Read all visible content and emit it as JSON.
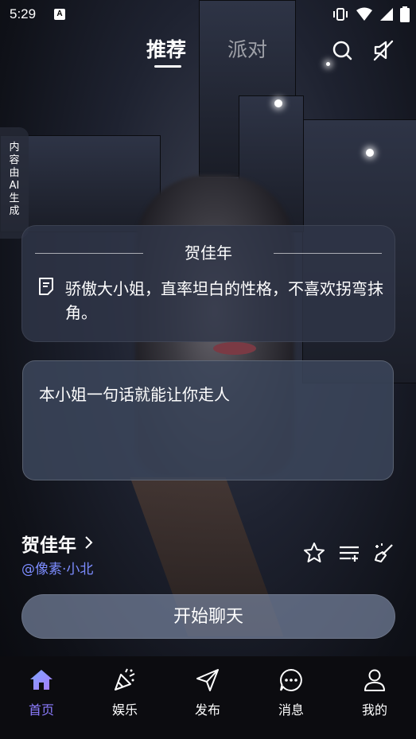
{
  "status_bar": {
    "time": "5:29",
    "app_badge": "A"
  },
  "top_tabs": [
    {
      "label": "推荐",
      "active": true
    },
    {
      "label": "派对",
      "active": false
    }
  ],
  "ai_label": [
    "内",
    "容",
    "由",
    "AI",
    "生",
    "成"
  ],
  "profile_card": {
    "name": "贺佳年",
    "description": "骄傲大小姐，直率坦白的性格，不喜欢拐弯抹角。"
  },
  "greeting": "本小姐一句话就能让你走人",
  "character": {
    "name": "贺佳年",
    "author": "@像素·小北"
  },
  "start_button": "开始聊天",
  "bottom_nav": [
    {
      "label": "首页",
      "icon": "home-icon",
      "active": true
    },
    {
      "label": "娱乐",
      "icon": "party-popper-icon",
      "active": false
    },
    {
      "label": "发布",
      "icon": "send-icon",
      "active": false
    },
    {
      "label": "消息",
      "icon": "message-icon",
      "active": false
    },
    {
      "label": "我的",
      "icon": "user-icon",
      "active": false
    }
  ],
  "colors": {
    "accent": "#8c7cff",
    "author_link": "#7c8cff",
    "nav_bg": "#0c0c10"
  }
}
